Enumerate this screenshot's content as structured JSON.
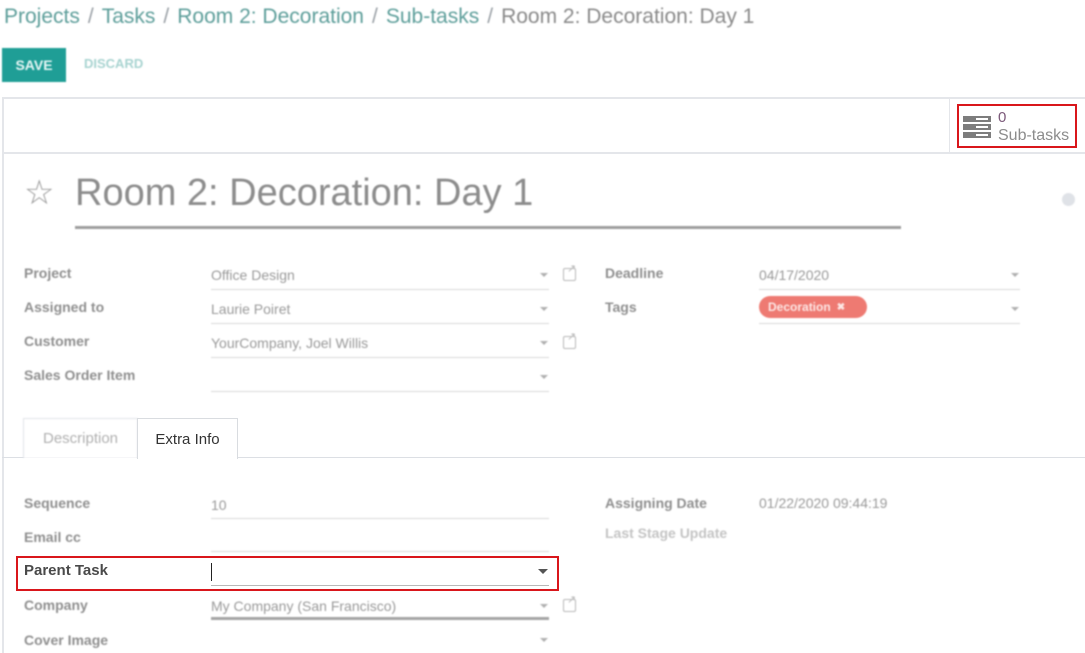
{
  "breadcrumb": {
    "items": [
      "Projects",
      "Tasks",
      "Room 2: Decoration",
      "Sub-tasks"
    ],
    "separator": "/",
    "current": "Room 2: Decoration: Day 1"
  },
  "toolbar": {
    "save_label": "SAVE",
    "discard_label": "DISCARD"
  },
  "stat_button": {
    "value": "0",
    "label": "Sub-tasks",
    "icon": "tasks-icon"
  },
  "task": {
    "title": "Room 2: Decoration: Day 1",
    "favorite_icon": "star-outline-icon"
  },
  "fields_left": [
    {
      "label": "Project",
      "value": "Office Design",
      "external_link": true
    },
    {
      "label": "Assigned to",
      "value": "Laurie Poiret",
      "external_link": false
    },
    {
      "label": "Customer",
      "value": "YourCompany, Joel Willis",
      "external_link": true
    },
    {
      "label": "Sales Order Item",
      "value": "",
      "external_link": false
    }
  ],
  "fields_right": [
    {
      "label": "Deadline",
      "value": "04/17/2020"
    },
    {
      "label": "Tags",
      "tags": [
        "Decoration"
      ]
    }
  ],
  "colors": {
    "accent": "#1f9e96",
    "tag": "#ee7a72",
    "highlight": "#d9161b"
  },
  "tabs": [
    {
      "label": "Description",
      "active": false
    },
    {
      "label": "Extra Info",
      "active": true
    }
  ],
  "extra_info_left": [
    {
      "label": "Sequence",
      "value": "10"
    },
    {
      "label": "Email cc",
      "value": ""
    },
    {
      "label": "Parent Task",
      "value": ""
    },
    {
      "label": "Company",
      "value": "My Company (San Francisco)"
    },
    {
      "label": "Cover Image",
      "value": ""
    }
  ],
  "extra_info_right": [
    {
      "label": "Assigning Date",
      "value": "01/22/2020 09:44:19"
    },
    {
      "label": "Last Stage Update",
      "value": ""
    }
  ]
}
